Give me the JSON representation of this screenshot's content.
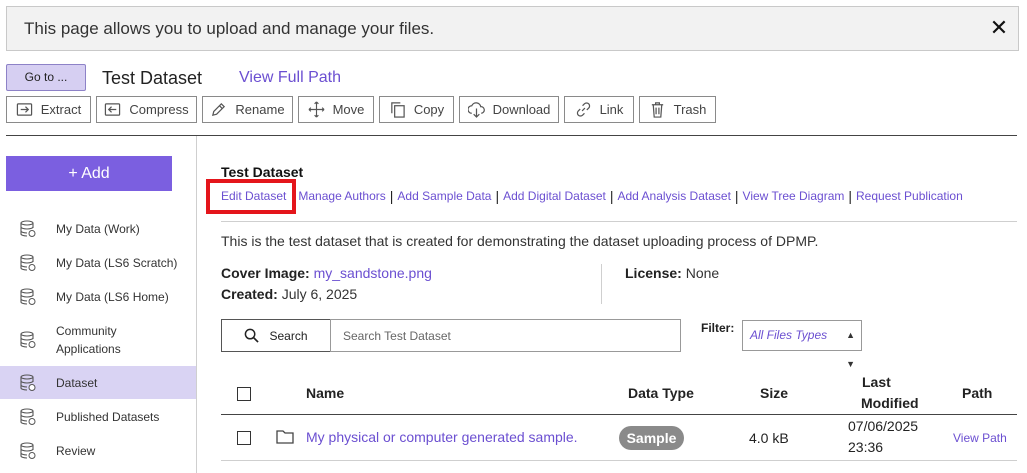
{
  "banner": {
    "text": "This page allows you to upload and manage your files.",
    "close_icon": "close-icon"
  },
  "path": {
    "goto_label": "Go to ...",
    "title": "Test Dataset",
    "view_full_path": "View Full Path"
  },
  "toolbar": [
    {
      "label": "Extract",
      "icon": "extract-icon"
    },
    {
      "label": "Compress",
      "icon": "compress-icon"
    },
    {
      "label": "Rename",
      "icon": "pencil-icon"
    },
    {
      "label": "Move",
      "icon": "move-icon"
    },
    {
      "label": "Copy",
      "icon": "copy-icon"
    },
    {
      "label": "Download",
      "icon": "download-icon"
    },
    {
      "label": "Link",
      "icon": "link-icon"
    },
    {
      "label": "Trash",
      "icon": "trash-icon"
    }
  ],
  "sidebar": {
    "add_label": "+ Add",
    "items": [
      {
        "label": "My Data (Work)",
        "icon": "database-icon"
      },
      {
        "label": "My Data (LS6 Scratch)",
        "icon": "database-icon"
      },
      {
        "label": "My Data (LS6 Home)",
        "icon": "database-icon"
      },
      {
        "label_line1": "Community",
        "label_line2": "Applications",
        "icon": "database-icon"
      },
      {
        "label": "Dataset",
        "icon": "database-icon",
        "active": true
      },
      {
        "label": "Published Datasets",
        "icon": "database-icon"
      },
      {
        "label": "Review",
        "icon": "database-icon"
      }
    ]
  },
  "dataset": {
    "title": "Test Dataset",
    "actions": [
      "Edit Dataset",
      "Manage Authors",
      "Add Sample Data",
      "Add Digital Dataset",
      "Add Analysis Dataset",
      "View Tree Diagram",
      "Request Publication"
    ],
    "separator": "|",
    "description": "This is the test dataset that is created for demonstrating the dataset uploading process of DPMP.",
    "cover_label": "Cover Image:",
    "cover_value": "my_sandstone.png",
    "created_label": "Created:",
    "created_value": "July 6, 2025",
    "license_label": "License:",
    "license_value": "None"
  },
  "search": {
    "button_label": "Search",
    "placeholder": "Search Test Dataset"
  },
  "filter": {
    "label": "Filter:",
    "selected": "All Files Types"
  },
  "table": {
    "headers": {
      "name": "Name",
      "data_type": "Data Type",
      "size": "Size",
      "last_modified_1": "Last",
      "last_modified_2": "Modified",
      "path": "Path"
    },
    "rows": [
      {
        "name": "My physical or computer generated sample.",
        "data_type": "Sample",
        "size": "4.0 kB",
        "date": "07/06/2025",
        "time": "23:36",
        "path": "View Path"
      }
    ]
  },
  "colors": {
    "accent": "#7b5fe0",
    "link": "#6b4fd1",
    "highlight": "#e4151b",
    "active_bg": "#d9d3f3"
  }
}
